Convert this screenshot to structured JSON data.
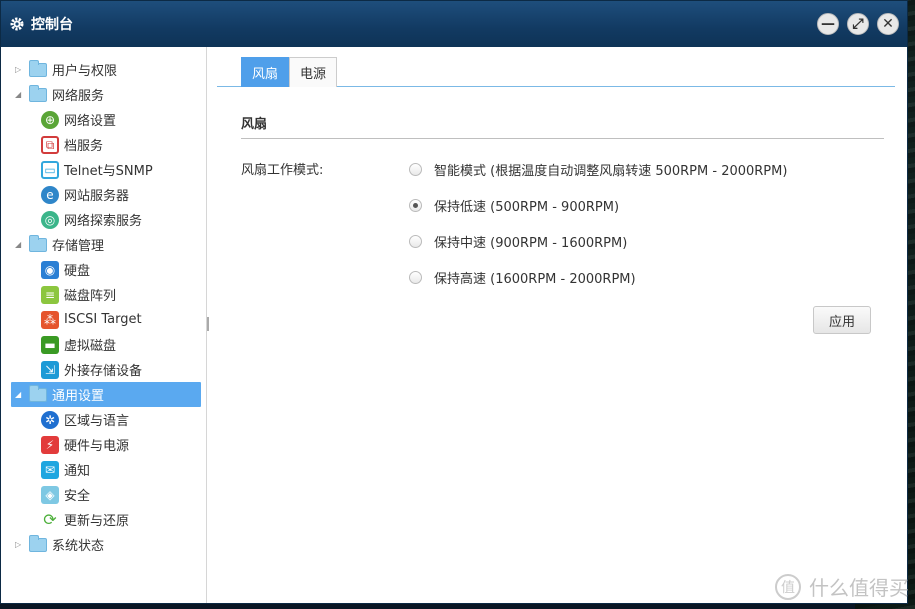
{
  "window": {
    "title": "控制台",
    "icon": "gear-icon"
  },
  "window_buttons": [
    {
      "name": "minimize-icon",
      "glyph": "—"
    },
    {
      "name": "maximize-icon",
      "glyph": "⤢"
    },
    {
      "name": "close-icon",
      "glyph": "✕"
    }
  ],
  "sidebar": {
    "g1": {
      "label": "用户与权限",
      "expanded": false
    },
    "g2": {
      "label": "网络服务",
      "expanded": true,
      "items": [
        "网络设置",
        "档服务",
        "Telnet与SNMP",
        "网站服务器",
        "网络探索服务"
      ]
    },
    "g3": {
      "label": "存储管理",
      "expanded": true,
      "items": [
        "硬盘",
        "磁盘阵列",
        "ISCSI Target",
        "虚拟磁盘",
        "外接存储设备"
      ]
    },
    "g4": {
      "label": "通用设置",
      "expanded": true,
      "selected": true,
      "items": [
        "区域与语言",
        "硬件与电源",
        "通知",
        "安全",
        "更新与还原"
      ]
    },
    "g5": {
      "label": "系统状态",
      "expanded": false
    }
  },
  "tabs": [
    {
      "label": "风扇",
      "active": true
    },
    {
      "label": "电源",
      "active": false
    }
  ],
  "fan": {
    "section_title": "风扇",
    "mode_label": "风扇工作模式:",
    "options": [
      "智能模式 (根据温度自动调整风扇转速 500RPM - 2000RPM)",
      "保持低速 (500RPM - 900RPM)",
      "保持中速 (900RPM - 1600RPM)",
      "保持高速 (1600RPM - 2000RPM)"
    ],
    "selected_index": 1,
    "apply_label": "应用"
  },
  "watermark": {
    "text": "什么值得买",
    "glyph": "值"
  },
  "colors": {
    "accent": "#4f9fea",
    "selected_row": "#5aa9f0",
    "titlebar": "#154170"
  }
}
